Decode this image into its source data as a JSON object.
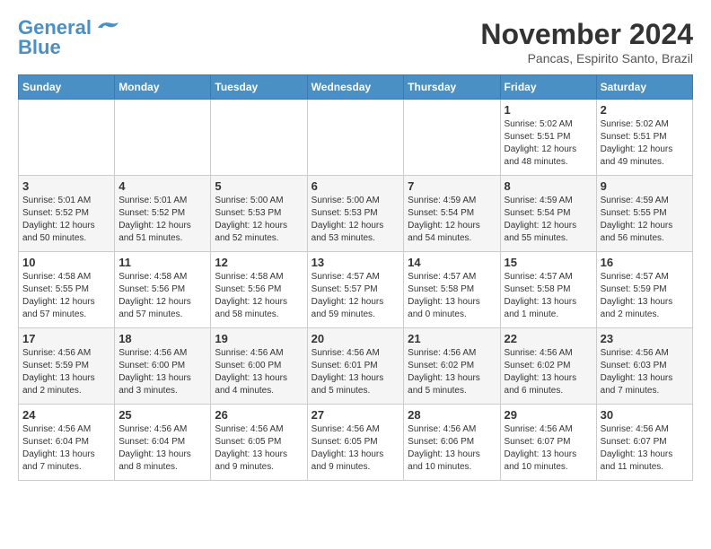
{
  "header": {
    "logo_line1": "General",
    "logo_line2": "Blue",
    "month": "November 2024",
    "location": "Pancas, Espirito Santo, Brazil"
  },
  "weekdays": [
    "Sunday",
    "Monday",
    "Tuesday",
    "Wednesday",
    "Thursday",
    "Friday",
    "Saturday"
  ],
  "weeks": [
    [
      {
        "day": "",
        "info": ""
      },
      {
        "day": "",
        "info": ""
      },
      {
        "day": "",
        "info": ""
      },
      {
        "day": "",
        "info": ""
      },
      {
        "day": "",
        "info": ""
      },
      {
        "day": "1",
        "info": "Sunrise: 5:02 AM\nSunset: 5:51 PM\nDaylight: 12 hours\nand 48 minutes."
      },
      {
        "day": "2",
        "info": "Sunrise: 5:02 AM\nSunset: 5:51 PM\nDaylight: 12 hours\nand 49 minutes."
      }
    ],
    [
      {
        "day": "3",
        "info": "Sunrise: 5:01 AM\nSunset: 5:52 PM\nDaylight: 12 hours\nand 50 minutes."
      },
      {
        "day": "4",
        "info": "Sunrise: 5:01 AM\nSunset: 5:52 PM\nDaylight: 12 hours\nand 51 minutes."
      },
      {
        "day": "5",
        "info": "Sunrise: 5:00 AM\nSunset: 5:53 PM\nDaylight: 12 hours\nand 52 minutes."
      },
      {
        "day": "6",
        "info": "Sunrise: 5:00 AM\nSunset: 5:53 PM\nDaylight: 12 hours\nand 53 minutes."
      },
      {
        "day": "7",
        "info": "Sunrise: 4:59 AM\nSunset: 5:54 PM\nDaylight: 12 hours\nand 54 minutes."
      },
      {
        "day": "8",
        "info": "Sunrise: 4:59 AM\nSunset: 5:54 PM\nDaylight: 12 hours\nand 55 minutes."
      },
      {
        "day": "9",
        "info": "Sunrise: 4:59 AM\nSunset: 5:55 PM\nDaylight: 12 hours\nand 56 minutes."
      }
    ],
    [
      {
        "day": "10",
        "info": "Sunrise: 4:58 AM\nSunset: 5:55 PM\nDaylight: 12 hours\nand 57 minutes."
      },
      {
        "day": "11",
        "info": "Sunrise: 4:58 AM\nSunset: 5:56 PM\nDaylight: 12 hours\nand 57 minutes."
      },
      {
        "day": "12",
        "info": "Sunrise: 4:58 AM\nSunset: 5:56 PM\nDaylight: 12 hours\nand 58 minutes."
      },
      {
        "day": "13",
        "info": "Sunrise: 4:57 AM\nSunset: 5:57 PM\nDaylight: 12 hours\nand 59 minutes."
      },
      {
        "day": "14",
        "info": "Sunrise: 4:57 AM\nSunset: 5:58 PM\nDaylight: 13 hours\nand 0 minutes."
      },
      {
        "day": "15",
        "info": "Sunrise: 4:57 AM\nSunset: 5:58 PM\nDaylight: 13 hours\nand 1 minute."
      },
      {
        "day": "16",
        "info": "Sunrise: 4:57 AM\nSunset: 5:59 PM\nDaylight: 13 hours\nand 2 minutes."
      }
    ],
    [
      {
        "day": "17",
        "info": "Sunrise: 4:56 AM\nSunset: 5:59 PM\nDaylight: 13 hours\nand 2 minutes."
      },
      {
        "day": "18",
        "info": "Sunrise: 4:56 AM\nSunset: 6:00 PM\nDaylight: 13 hours\nand 3 minutes."
      },
      {
        "day": "19",
        "info": "Sunrise: 4:56 AM\nSunset: 6:00 PM\nDaylight: 13 hours\nand 4 minutes."
      },
      {
        "day": "20",
        "info": "Sunrise: 4:56 AM\nSunset: 6:01 PM\nDaylight: 13 hours\nand 5 minutes."
      },
      {
        "day": "21",
        "info": "Sunrise: 4:56 AM\nSunset: 6:02 PM\nDaylight: 13 hours\nand 5 minutes."
      },
      {
        "day": "22",
        "info": "Sunrise: 4:56 AM\nSunset: 6:02 PM\nDaylight: 13 hours\nand 6 minutes."
      },
      {
        "day": "23",
        "info": "Sunrise: 4:56 AM\nSunset: 6:03 PM\nDaylight: 13 hours\nand 7 minutes."
      }
    ],
    [
      {
        "day": "24",
        "info": "Sunrise: 4:56 AM\nSunset: 6:04 PM\nDaylight: 13 hours\nand 7 minutes."
      },
      {
        "day": "25",
        "info": "Sunrise: 4:56 AM\nSunset: 6:04 PM\nDaylight: 13 hours\nand 8 minutes."
      },
      {
        "day": "26",
        "info": "Sunrise: 4:56 AM\nSunset: 6:05 PM\nDaylight: 13 hours\nand 9 minutes."
      },
      {
        "day": "27",
        "info": "Sunrise: 4:56 AM\nSunset: 6:05 PM\nDaylight: 13 hours\nand 9 minutes."
      },
      {
        "day": "28",
        "info": "Sunrise: 4:56 AM\nSunset: 6:06 PM\nDaylight: 13 hours\nand 10 minutes."
      },
      {
        "day": "29",
        "info": "Sunrise: 4:56 AM\nSunset: 6:07 PM\nDaylight: 13 hours\nand 10 minutes."
      },
      {
        "day": "30",
        "info": "Sunrise: 4:56 AM\nSunset: 6:07 PM\nDaylight: 13 hours\nand 11 minutes."
      }
    ]
  ]
}
